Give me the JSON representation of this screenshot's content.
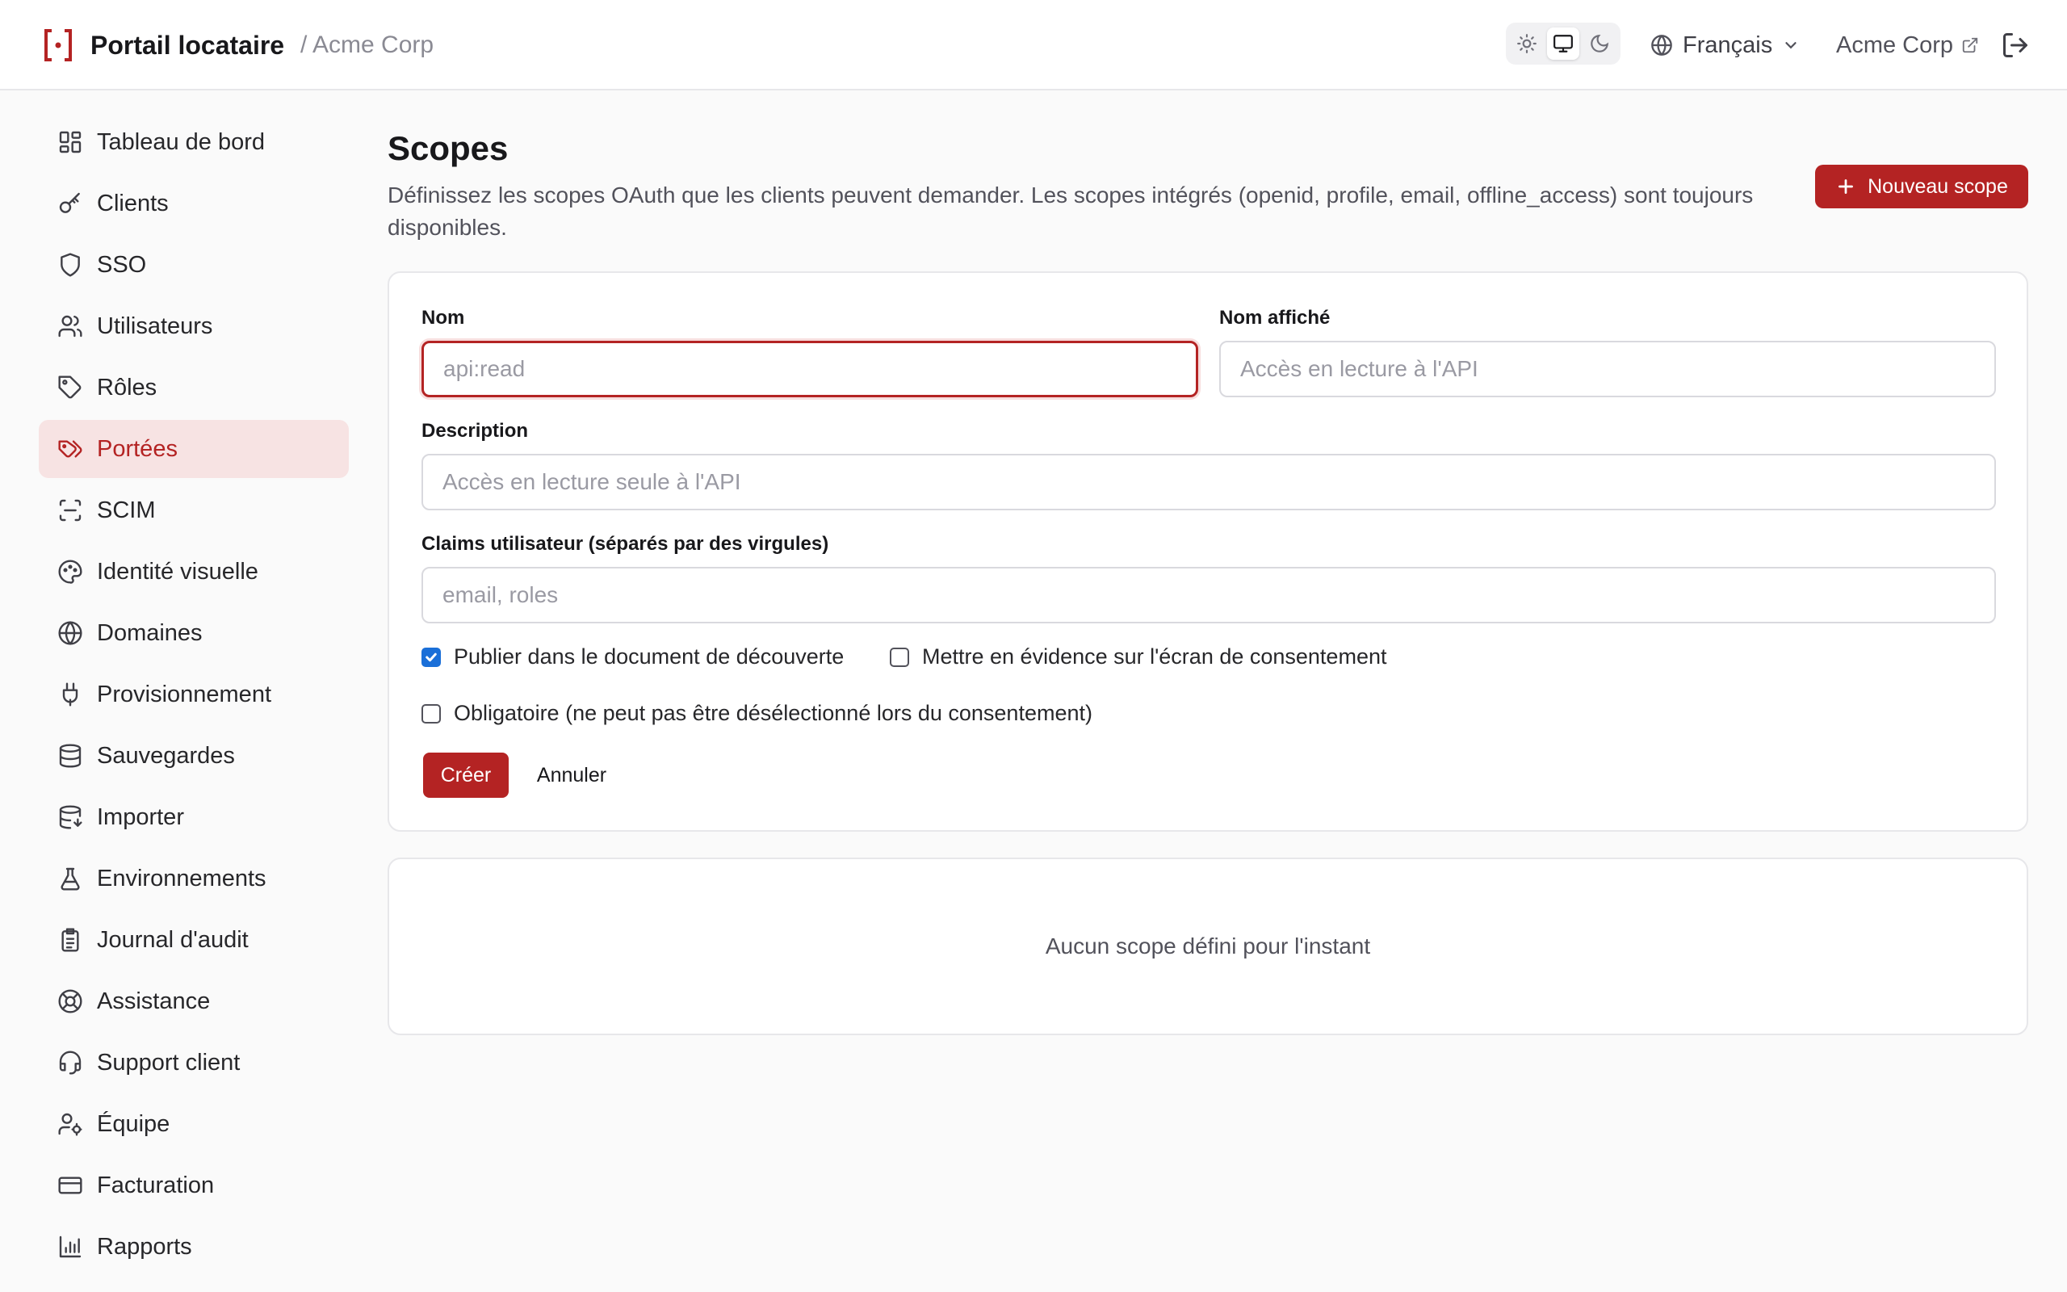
{
  "header": {
    "app_title": "Portail locataire",
    "breadcrumb": "/ Acme Corp",
    "language": "Français",
    "tenant_link": "Acme Corp",
    "theme_modes": [
      "light",
      "system",
      "dark"
    ],
    "active_theme": "system"
  },
  "sidebar": {
    "items": [
      {
        "label": "Tableau de bord",
        "icon": "dashboard-icon"
      },
      {
        "label": "Clients",
        "icon": "key-icon"
      },
      {
        "label": "SSO",
        "icon": "shield-icon"
      },
      {
        "label": "Utilisateurs",
        "icon": "users-icon"
      },
      {
        "label": "Rôles",
        "icon": "tag-icon"
      },
      {
        "label": "Portées",
        "icon": "tags-icon",
        "active": true
      },
      {
        "label": "SCIM",
        "icon": "scan-icon"
      },
      {
        "label": "Identité visuelle",
        "icon": "palette-icon"
      },
      {
        "label": "Domaines",
        "icon": "globe-icon"
      },
      {
        "label": "Provisionnement",
        "icon": "plug-icon"
      },
      {
        "label": "Sauvegardes",
        "icon": "database-icon"
      },
      {
        "label": "Importer",
        "icon": "database-import-icon"
      },
      {
        "label": "Environnements",
        "icon": "flask-icon"
      },
      {
        "label": "Journal d'audit",
        "icon": "clipboard-icon"
      },
      {
        "label": "Assistance",
        "icon": "lifebuoy-icon"
      },
      {
        "label": "Support client",
        "icon": "headset-icon"
      },
      {
        "label": "Équipe",
        "icon": "user-cog-icon"
      },
      {
        "label": "Facturation",
        "icon": "credit-card-icon"
      },
      {
        "label": "Rapports",
        "icon": "bar-chart-icon"
      }
    ]
  },
  "main": {
    "title": "Scopes",
    "description": "Définissez les scopes OAuth que les clients peuvent demander. Les scopes intégrés (openid, profile, email, offline_access) sont toujours disponibles.",
    "new_button": "Nouveau scope",
    "form": {
      "name_label": "Nom",
      "name_placeholder": "api:read",
      "name_value": "",
      "display_label": "Nom affiché",
      "display_placeholder": "Accès en lecture à l'API",
      "display_value": "",
      "description_label": "Description",
      "description_placeholder": "Accès en lecture seule à l'API",
      "description_value": "",
      "claims_label": "Claims utilisateur (séparés par des virgules)",
      "claims_placeholder": "email, roles",
      "claims_value": "",
      "checkboxes": [
        {
          "label": "Publier dans le document de découverte",
          "checked": true
        },
        {
          "label": "Mettre en évidence sur l'écran de consentement",
          "checked": false
        },
        {
          "label": "Obligatoire (ne peut pas être désélectionné lors du consentement)",
          "checked": false
        }
      ],
      "create_button": "Créer",
      "cancel_button": "Annuler"
    },
    "empty_state": "Aucun scope défini pour l'instant"
  },
  "colors": {
    "accent": "#b42323",
    "accent_soft": "#f7e3e3",
    "checkbox": "#1a6fd8"
  }
}
